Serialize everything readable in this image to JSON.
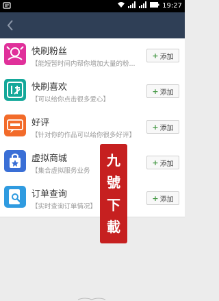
{
  "status_bar": {
    "time": "19:27"
  },
  "header": {
    "back_icon": "chevron-left-icon"
  },
  "items": [
    {
      "title": "快刷粉丝",
      "desc": "【能短暂时间内帮你增加大量的粉...",
      "button": "添加",
      "icon": "fans-icon",
      "color": "#e0309a"
    },
    {
      "title": "快刷喜欢",
      "desc": "【可以给你点击很多爱心】",
      "button": "添加",
      "icon": "kuai-icon",
      "color": "#14a89a"
    },
    {
      "title": "好评",
      "desc": "【针对你的作品可以给你很多好评】",
      "button": "添加",
      "icon": "review-icon",
      "color": "#f26b2a"
    },
    {
      "title": "虚拟商城",
      "desc": "【集合虚拟服务业务",
      "button": "添加",
      "icon": "shopping-bag-icon",
      "color": "#3a6fd6"
    },
    {
      "title": "订单查询",
      "desc": "【实时查询订单情况】",
      "button": "添加",
      "icon": "order-search-icon",
      "color": "#2f9be0"
    }
  ],
  "watermark": {
    "chars": [
      "九",
      "號",
      "下",
      "載"
    ],
    "color": "#c62020"
  }
}
